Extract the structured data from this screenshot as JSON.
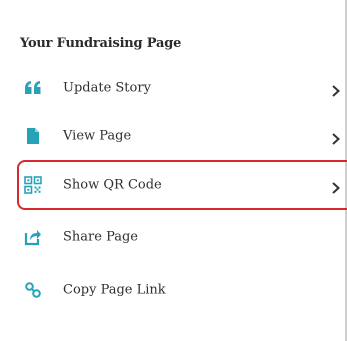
{
  "header": {
    "title": "Your Fundraising Page"
  },
  "colors": {
    "accent": "#27a3b8",
    "highlight": "#d42a2f",
    "text": "#2f2f2f"
  },
  "menu": [
    {
      "label": "Update Story",
      "icon": "quote-icon",
      "has_chevron": true
    },
    {
      "label": "View Page",
      "icon": "document-icon",
      "has_chevron": true
    },
    {
      "label": "Show QR Code",
      "icon": "qr-code-icon",
      "has_chevron": true,
      "highlighted": true
    },
    {
      "label": "Share Page",
      "icon": "share-icon",
      "has_chevron": false
    },
    {
      "label": "Copy Page Link",
      "icon": "link-icon",
      "has_chevron": false
    }
  ]
}
